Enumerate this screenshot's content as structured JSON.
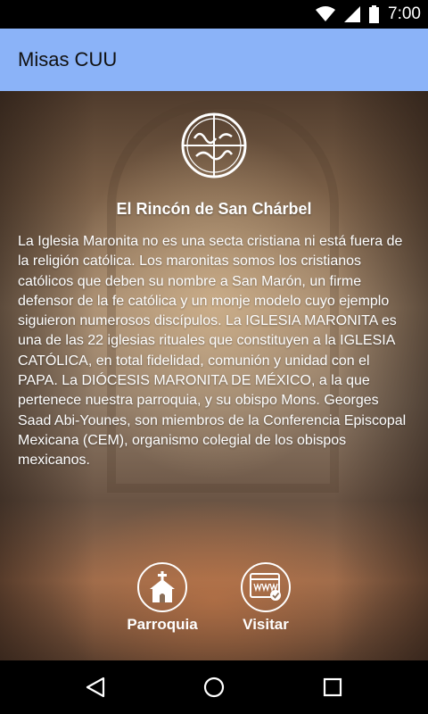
{
  "status_bar": {
    "time": "7:00",
    "icons": [
      "wifi-icon",
      "signal-icon",
      "battery-icon"
    ]
  },
  "app_bar": {
    "title": "Misas CUU"
  },
  "main": {
    "heading": "El Rincón de San Chárbel",
    "body": "La Iglesia Maronita no es una secta cristiana ni está fuera de la religión católica. Los maronitas somos los cristianos católicos que deben su nombre a San Marón, un firme defensor de la fe católica y un monje modelo cuyo ejemplo siguieron numerosos discípulos. La IGLESIA MARONITA es una de las 22 iglesias rituales que constituyen a la IGLESIA CATÓLICA, en total fidelidad, comunión y unidad con el PAPA. La DIÓCESIS MARONITA DE MÉXICO, a la que pertenece nuestra parroquia, y su obispo Mons. Georges Saad Abi-Younes, son miembros de la Conferencia Episcopal Mexicana (CEM), organismo colegial de los obispos mexicanos.",
    "actions": [
      {
        "label": "Parroquia",
        "icon": "church-icon"
      },
      {
        "label": "Visitar",
        "icon": "www-icon"
      }
    ]
  },
  "nav_bar": {
    "buttons": [
      "back-icon",
      "home-icon",
      "recents-icon"
    ]
  },
  "colors": {
    "app_bar": "#8bb3f8",
    "text": "#ffffff"
  }
}
